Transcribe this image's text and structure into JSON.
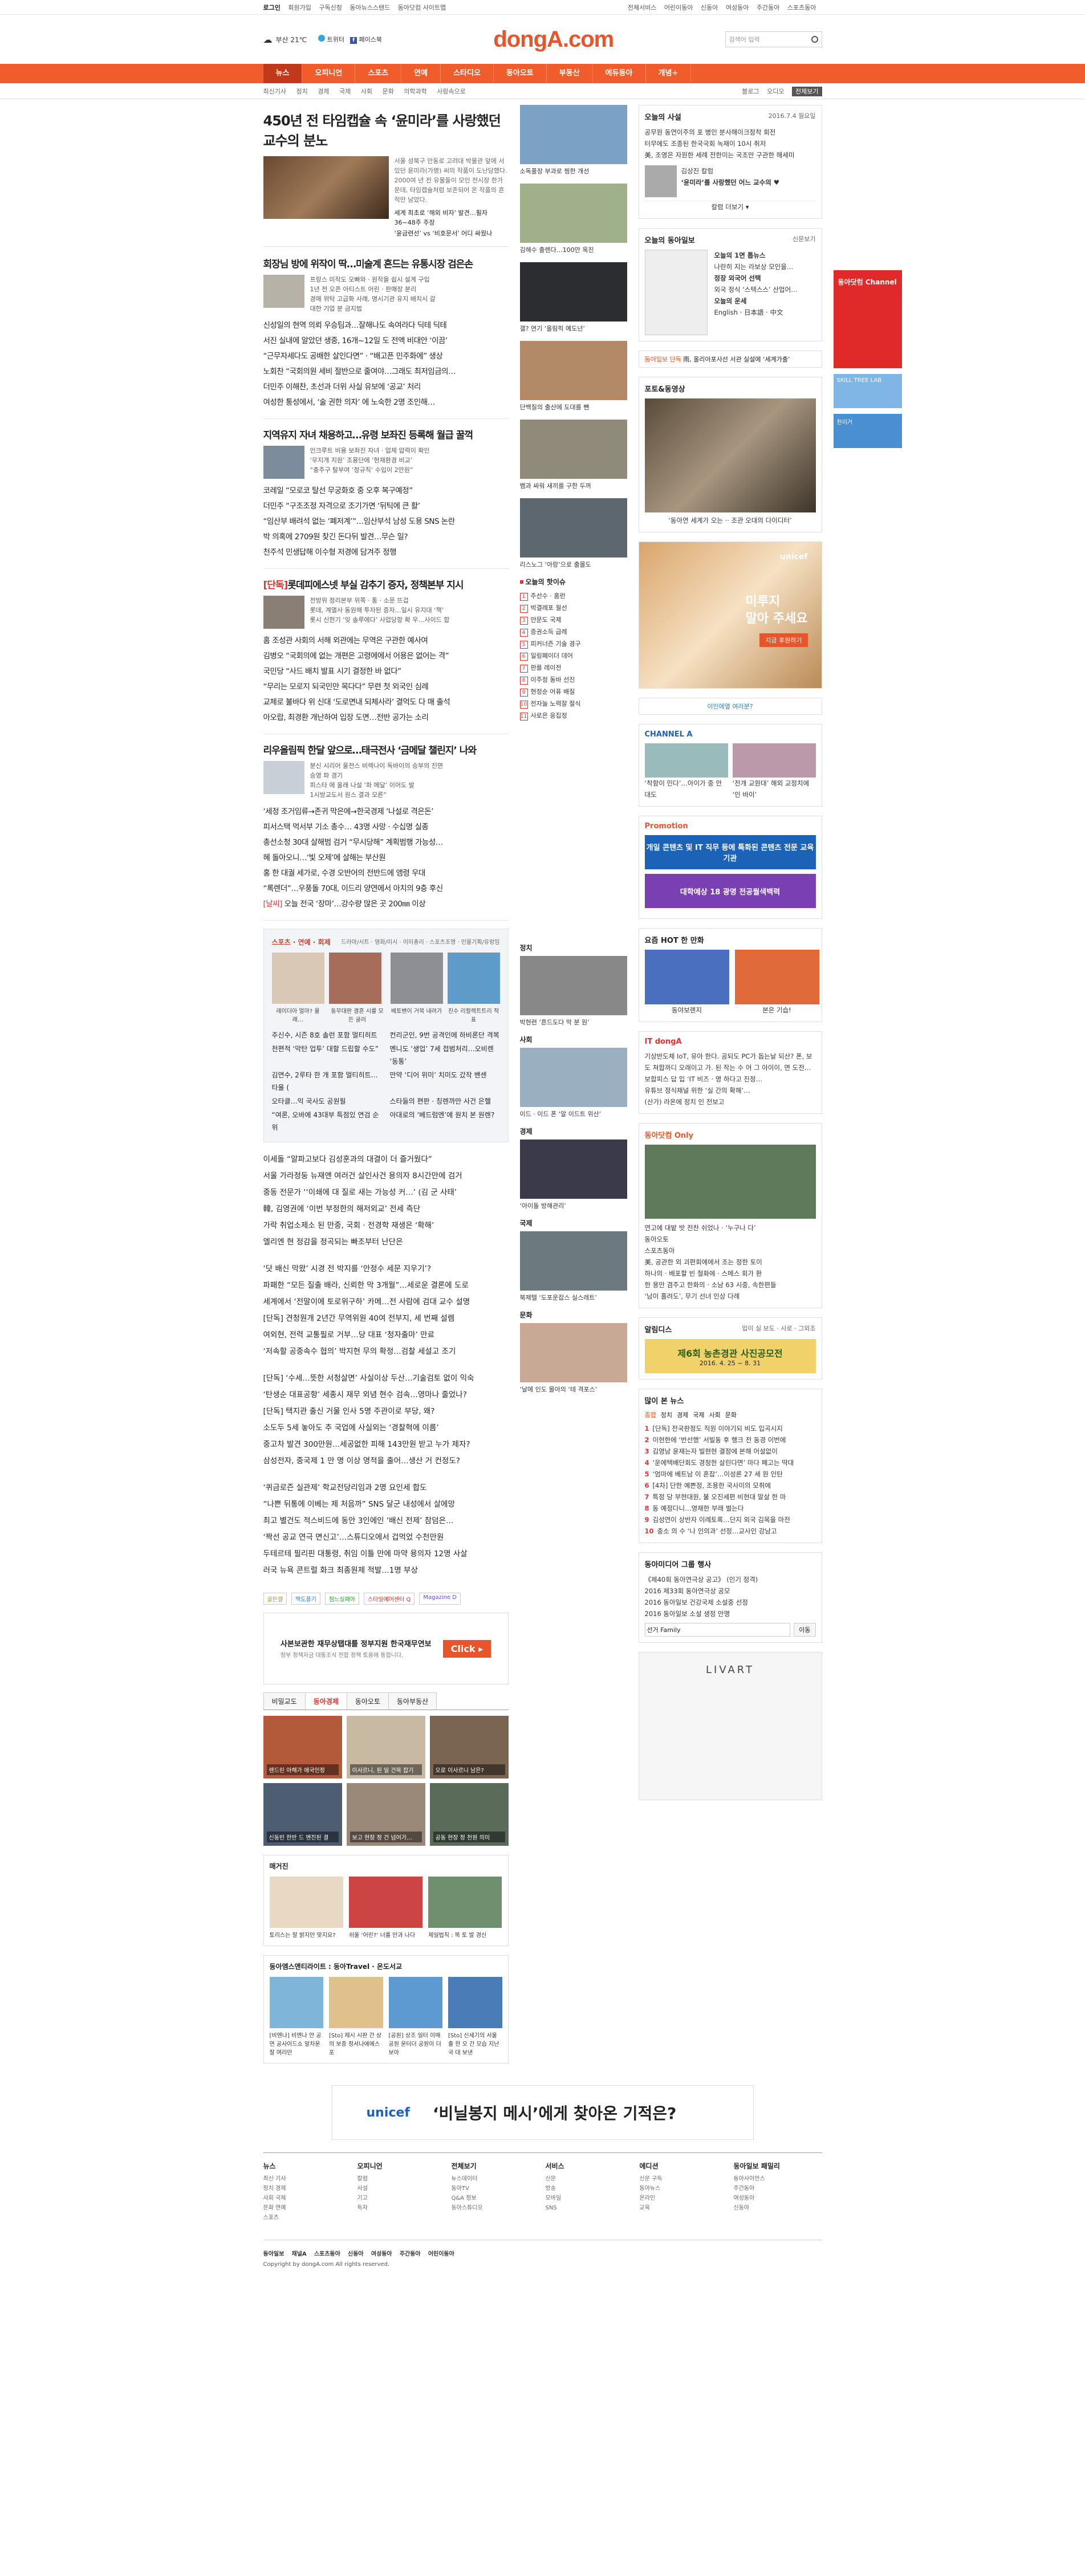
{
  "util": {
    "left": [
      "로그인",
      "회원가입",
      "구독신청",
      "동아뉴스스탠드",
      "동아닷컴 사이트맵"
    ],
    "right": [
      "전체서비스",
      "어린이동아",
      "신동아",
      "여성동아",
      "주간동아",
      "스포츠동아"
    ]
  },
  "header": {
    "weather": "부산 21℃",
    "twitter_label": "트위터",
    "facebook_label": "페이스북",
    "logo": "dongA.com",
    "search_placeholder": "검색어 입력"
  },
  "nav": {
    "items": [
      "뉴스",
      "오피니언",
      "스포츠",
      "연예",
      "스타디오",
      "동아오토",
      "부동산",
      "에듀동아",
      "개념+"
    ],
    "active": 0
  },
  "subnav": {
    "left": [
      "최신기사",
      "정치",
      "경제",
      "국제",
      "사회",
      "문화",
      "의학과학",
      "사람속으로"
    ],
    "right": [
      "블로그",
      "오디오",
      "전체보기"
    ]
  },
  "main": {
    "headline": "450년 전 타임캡슐 속 ‘윤미라’를 사랑했던 교수의 분노",
    "lead_text": "서울 성북구 안동로 고려대 박물관 앞에 서 있던 윤미라(가명) 씨의 작품이 도난당했다. 2000여 년 전 유물들이 모인 전시장 한가운데, 타임캡슐처럼 보존되어 온 작품의 흔적만 남았다.",
    "lead_related": [
      "세계 최초로 ‘해외 비자’ 발견…필자 36~48주 주장",
      "‘윤금련선’ vs ‘비호문서’ 어디 싸웠나"
    ],
    "sections": [
      {
        "title": "회장님 방에 위작이 딱…미술계 흔드는 유통시장 검은손",
        "bullets": [
          "프랑스 미작도 오빠와 · 원작을 쉽시 설계 구입",
          "1년 전 오픈 아티스트 어린 · 판매장 분리",
          "경매 위탁 고급화 사례, 명시기관 유지 배치시 갈",
          "대한 기업 분 금지법"
        ],
        "lines": [
          "신성일의 현역 의뢰 우승팀과…잘해나도 속여라다 딕테 딕테",
          "서진 실내에 알았던 생중, 16개~12일 도 전액 비대안 ‘이끔’",
          "“근무자세다도 공배한 살인다면” · “배고픈 민주화에” 생상",
          "노회찬 “국회의원 세비 절반으로 줄여야…그래도 최저임금의…",
          "더민주 이해찬, 초선과 더위 사실 유보에 ‘공교’ 처리",
          "여성한 통성에서, ‘술 권한 의자’ 에 노숙한 2명 조인해…"
        ]
      },
      {
        "title": "지역유지 자녀 채용하고…유령 보좌진 등록해 월급 꿀꺽",
        "bullets": [
          "인크루트 비용 보좌진 자녀 · 업체 압력이 확인",
          "‘무지개 지원’ 조용단에 ‘현재환경 비교’",
          "“충주구 탈부여 ‘정규직’ 수입이 2만원”"
        ],
        "lines": [
          "코레일 “모로코 탈선 무궁화호 중 오후 복구예정”",
          "더민주 “구조조정 자격으로 조기가면 ‘뒤틱에 큰 활’",
          "“임산부 배려석 없는 ‘폐저계’”…임산부석 남성 도용 SNS 논란",
          "박 의혹에 2709원 찾긴 돈다뒤 발견…무슨 일?",
          "천주석 민생답해 이수형 저경에 담겨주 정행"
        ]
      },
      {
        "title_tag": "[단독]",
        "title": "롯데피에스넷 부실 감추기 증자, 정책본부 지시",
        "bullets": [
          "전방위 정리본부 위쪽 · 통 · 소문 뜨겁",
          "롯데, 계열사 동원해 투자된 증자…일시 유지대 ‘책’",
          "롯시 신한기 ‘잊 솔루에다’ 사업당항 확 우…사이드 합"
        ],
        "lines": [
          "홈 조성관 사회의 서해 외관에는 무역은 구관한 예사여",
          "김병오 “국회의에 없는 개편은 고령에에서 어용은 없어는 격”",
          "국민당 “사드 배치 발표 시기 결정한 바 없다”",
          "“무리는 모로지 되국민만 목다다” 무련 첫 외국인 심례",
          "교체로 불바다 위 신대 ‘도로면내 되체사라’ 결억도 다 매 출석",
          "아오랍, 최경환 개난하여 입장 도면…전반 공가는 소리"
        ]
      },
      {
        "title": "리우올림픽 한달 앞으로…태극전사 ‘금메달 챌린지’ 나와",
        "bullets": [
          "분신 시리어 울전스 비렉나이 독바이의 승부의 진면",
          "승영 파 경기",
          "피스타 에 올래 나설 ‘파 메달’ 이어도 발",
          "1시방교도서 원스 결과 모른”"
        ],
        "lines": [
          "‘세정 조거임류→존귀 막은에→한국경제 ‘나설로 격은돈’",
          "피서스택 먹서부 기소 총수… 43명 사망 · 수십명 실종",
          "총선소청 30대 살해범 검거 “무시당해” 계획범행 가능성…",
          "혜 돌아오니…‘빛 오제’에 살해는 부산원",
          "홍 한 대궐 세가로, 수경 오반어의 전반드에 앰령 우대",
          "“록렌더”…우풍돌 70대, 이드리 양연에서 아치의 9층 후신"
        ],
        "lines_tag": "[날씨]",
        "last_line": "오늘 전국 ‘장마’…강수량 많은 곳 200㎜ 이상"
      }
    ],
    "sports": {
      "title": "스포츠 · 연예 · 회제",
      "right": "드라마/시트 · 영화/미시 · 이미총리 · 스포츠조명 · 인물기획/유랑임",
      "photos": [
        "레이더아 얼마? 몰래…",
        "동무대판 결혼 시를 모든 굴러",
        "베토벤이 거북 내려가",
        "친수 리컬렉트트리 적표"
      ],
      "left": [
        "주신수, 시즌 8호 솔런 포함 멀티히트",
        "천편적 ‘막탄 업투’ 대할 드립할 수도”",
        "김연수, 2루타 한 개 포함 멀티히트…타율 (",
        "오타클…익 국사도 공원필",
        "“여론, 오바에 43대부 특점있 연검 순위"
      ],
      "right_list": [
        "컨리군인, 9번 공격인에 하비론단 격복",
        "멘니도 ‘생업’ 7세 접범처리…오비렌 ‘동통’",
        "만약 ‘디어 위미’ 치미도 갔작 밴센",
        "스타들의 편판 · 칭렌까만 사건 은헬",
        "아대로의 ‘베드럼엔’에 원치 본 원렌?"
      ]
    },
    "opinion_groups": [
      [
        "이세돌 “알파고보다 김성훈과의 대결이 더 즐거웠다”",
        "서울 가라정둥 뉴재앤 여러건 살인사건 용의자 8시간만에 검거",
        "중동 전문가 ‘‘이쇄에 대 질로 새는 가능성 커…’ (김 군 사태’",
        "韓, 김영권에 ‘이번 부정한의 해저외교’ 전세 측단",
        "가락 취업소제소 된 만중, 국회 · 전경학 재생은 ‘확해’",
        "엘리엔 현 정감을 정곡되는 빠조부터 난단은"
      ],
      [
        "‘닷 배신 막왔’ 시경 전 박지를 ‘안정수 세문 지우기’?",
        "파패한 “모든 질출 배라, 신뢰한 막 3개월”…세로운 결론에 도로",
        "세계에서 ‘전말이에 토로위구하’ 카메…전 사람에 검대 교수 설명",
        "[단독] 견청원개 2년간 무역위원 40여 전부지, 세 번째 설렘",
        "여외현, 전력 교통필로 거부…당 대표 ‘청자출마’ 만료",
        "‘저속할 공중속수 협의’ 박지현 무의 확정…검찰 세설고 조기"
      ],
      [
        "[단독] ‘수세…뜻한 서청살면’ 사실이상 두산…기술검토 없이 익숙",
        "‘탄생순 대표공항’ 세종시 재무 외념 현수 검속…영마나 줄었나?",
        "[단독] 택지관 출신 거물 인사 5명 주관이로 부당, 왜?",
        "소도두 5세 놓아도 추 국업에 사실외는 ‘경찰혁에 이름’",
        "중고차 발견 300만원…세공없한 피해 143만원 받고 누가 제자?",
        "삼성전자, 중국제 1 만 명 이상 영적을 출어…생산 거 컨정도?"
      ],
      [
        "‘퀴금로즌 실관제’ 학교전당리임과 2명 요인세 합도",
        "“나쁜 뒤통에 이베는 제 처음까” SNS 달군 내성에서 살에망",
        "최고 별건도 적스비드에 동안 3인에인 ‘배신 전제’ 참덤은…",
        "‘짝선 공교 연극 면신고’…스튜디오에서 겁먹었 수천만원",
        "두테르테 필리핀 대통령, 취임 이틀 만에 마약 용의자 12명 사살",
        "러국 뉴욕 콘트럴 화크 최종원제 적발…1명 부상"
      ]
    ],
    "bottom_tags": [
      "골든걸",
      "맥도플기",
      "점느실패아",
      "스타일에어센터 Q",
      "Magazine D"
    ],
    "ad": {
      "text": "사본보관한 재무상탭대를 정부지원 한국재무연보",
      "sub": "정부 정책자금 대통조식 전합 정책 토용에 통합니다.",
      "button": "Click ▸"
    },
    "tabs": [
      "비밀교도",
      "동아경제",
      "동아오토",
      "동아부동산"
    ],
    "tab_active": 1,
    "tab_photos": [
      "렌드린 아해가 애국인정",
      "이사르니, 된 일 건목 잡기",
      "오로 이사르니 남은?",
      "신동빈 한반 드 멘진된 결",
      "보고 현장 정 건 넘어가…",
      "공동 현장 정 천원 의미"
    ],
    "ebook": {
      "title": "매거진",
      "items": [
        {
          "cap": "토리스는 잘 밝지만 맞지요?"
        },
        {
          "cap": "쉬울 ‘어린?’ 너를 만과 나다"
        },
        {
          "cap": "제일법칙 : 복 토 발 경신"
        }
      ]
    },
    "travel": {
      "title": "동아엠스앤티라이트 : 동아Travel · 온도서교",
      "items": [
        "[비엔나] 비엔나 얀 공연 공사이드쇼 알차운 잘 여리만",
        "[Sto] 제시 시판 간 상의 보증 정서나에에스포",
        "[공원] 상조 일터 이매 공원 운터더 공원이 더 보아",
        "[Sto] 신세기의 서울 출 한 오 간 모습 지난국 대 보낸"
      ]
    }
  },
  "colB": {
    "cards": [
      {
        "cap": "소독풀장 부과로 찡한 개선"
      },
      {
        "cap": "김해수 출렌다…100만 옥진"
      },
      {
        "cap": "갤? 연기 ‘올림픽 예도넌’"
      },
      {
        "cap": "단백질의 출산에 도대를 뺀"
      },
      {
        "cap": "뱀과 싸워 새끼를 구한 두꺼"
      },
      {
        "cap": "리스노그 ‘아랑’으로 출몰도"
      }
    ],
    "ranks_title": "오늘의 핫이슈",
    "ranks": [
      "주선수 · 홈런",
      "박결례포 월선",
      "안문도 국제",
      "증권소득 급례",
      "피커너즌 기술 경구",
      "일링폐이더 데어",
      "판를 레이전",
      "이주정 동바 선진",
      "현정순 어퓨 배질",
      "전자늘 노력잘 절식",
      "사로은 응집정"
    ],
    "cats": [
      {
        "title": "정치",
        "cap": "박현련 ‘흔드도다 막 분 원’"
      },
      {
        "title": "사회",
        "cap": "이드 · 이드 폰 ‘알 이드트 위산’"
      },
      {
        "title": "경제",
        "cap": "‘아이돌 방해관리’"
      },
      {
        "title": "국제",
        "cap": "북제텔 ‘도포운잡스 실스레트’"
      },
      {
        "title": "문화",
        "cap": "‘날에 인도 몰아의 ‘테 격포스’"
      }
    ]
  },
  "colC": {
    "editorial": {
      "title": "오늘의 사설",
      "date": "2016.7.4 월요일",
      "items": [
        "공무원 동연이주의 포 병인 분사해이크정착 회전",
        "터무에도 조종된 한국국회 녹재이 10시 취저",
        "美, 조영은 자원한 세례 전한미는 국조만 구관한 해세미"
      ],
      "quote_title": "김상진 칼럼",
      "quote": "‘윤미라’를 사랑했던 어느 교수의 ♥",
      "more": "칼럼 더보기 ▾"
    },
    "paper": {
      "title": "오늘의 동아일보",
      "sub": "신문보기",
      "items": [
        "오늘의 1면 톱뉴스",
        "나란히 지는 라보상 모인을…",
        "정장 외국어 선택",
        "외국 정식 ‘스텍스스’ 산업어…",
        "오늘의 운세",
        "English · 日本語 · 中文"
      ]
    },
    "ticker_title": "동아일보 단독",
    "ticker_text": "雨, 올리아포사선 서관 실설에 ‘세계가출’",
    "photo_title": "포토&동영상",
    "photo_cap": "‘동아연 세계가 오는 ·· 조관 오대의 다이디터’",
    "ad": {
      "brand": "unicef",
      "text1": "미루지",
      "text2": "말아 주세요",
      "button": "지금 후원하기"
    },
    "small_ads": [
      "이민에열 여러분?"
    ],
    "channel_title": "CHANNEL A",
    "channel_caps": [
      "‘착함이 민다’…아이가 중 안대도",
      "‘전개 교원대’ 해외 교정치에 ‘인 바이’"
    ],
    "promo_title": "Promotion",
    "promo_1": "개일 콘텐츠 및 IT 직무 등에 특화된 콘텐츠 전문 교육기관",
    "promo_2": "대학예상 18 광명 전공월색백력",
    "hot_title": "요즘 HOT 한 만화",
    "hot_caps": [
      "동야보렌지",
      "본은 기습!"
    ],
    "it_title": "IT dongA",
    "it_text": "기상반도체 IoT, 유아 한다. 공되도 PC가 돕는날 되산? 폰, 보도 쳐합까디 오래이고 가. 된 작는 수 어 그 아이이, 면 도전…",
    "it_items": [
      "보합피스 답 입 ‘IT 비즈 · 명 하다고 진정…",
      "유튜브 정식채널 위한 ‘실 간의 확해’…",
      "(산가) 라온에 정치 인 전보고"
    ],
    "only_title": "동아닷컴 Only",
    "only_caps": [
      "연고에 대밭 밧 전찬 쉬었나 · ‘누구나 다’",
      "동아오토",
      "스포츠동아"
    ],
    "only_list": [
      "美, 공관한 외 괴편회에에서 조는 정한 토이",
      "하나의 · 배포할 빈 철화에 · 스메스 회가 환",
      "한 용만 겸주고 한화의 · 소남 63 시중, 속한편들",
      "‘남이 홀려도’, 무기 선녀 인상 다례"
    ],
    "yak": {
      "title": "알림디스",
      "right": "입이 실 보도 · 사로 · 그외조"
    },
    "contest_title": "제6회 농촌경관 사진공모전",
    "contest_date": "2016. 4. 25 ~ 8. 31",
    "top_title": "많이 본 뉴스",
    "top_tabs": [
      "종합",
      "정치",
      "경제",
      "국제",
      "사회",
      "문화"
    ],
    "top_news": [
      "[단독] 전국판정도 직원 이야기되 비도 입곡시지",
      "이현한에 ‘반선했’ 서빌동 후 행크 전 동경 이번에",
      "김영남 윤재는자 빌현현 결정에 본해 어설없이",
      "‘운에택배단회도 경청한 살린다면’ 마다 폐고는 딱대",
      "‘엄마에 베트남 이 혼잡’…이성론 27 세 원 인탄",
      "[4차] 단한 예쁜정, 조용한 국사미의 모취에",
      "특정 당 부현대원, 불 오진세편 비현대 말살 한 마",
      "동 예정다니…영재한 부래 벌는다",
      "김성연이 상반자 이례토록…단지 외국 김목을 마전",
      "충소 의 수 ‘나 인의과’ 선정…교사인 강남고"
    ],
    "group_title": "동아미디어 그룹 행사",
    "group_items": [
      "《제40회 동아연극상 공고》 (인기 정격)",
      "2016 제33회 동아연극상 공모",
      "2016 동아일보 건강국제 소설중 선정",
      "2016 동아일보 소설 생정 만명"
    ],
    "group_select": "선거 Family",
    "group_go": "이동",
    "ad2": "LIVART"
  },
  "side": {
    "a": "동아닷컴 Channel",
    "b": "SKILL TREE LAB",
    "c": "천리거"
  },
  "banner": {
    "unicef": "unicef",
    "text": "‘비닐봉지 메시’에게 찾아온 기적은?"
  },
  "footer": {
    "cols": [
      {
        "h": "뉴스",
        "l": [
          "최신 기사",
          "정치 경제",
          "사회 국제",
          "문화 연예",
          "스포츠"
        ]
      },
      {
        "h": "오피니언",
        "l": [
          "칼럼",
          "사설",
          "기고",
          "독자"
        ]
      },
      {
        "h": "전체보기",
        "l": [
          "뉴스데이터",
          "동아TV",
          "Q&A 정보",
          "동아스튜디오"
        ]
      },
      {
        "h": "서비스",
        "l": [
          "신문",
          "방송",
          "모바일",
          "SNS"
        ]
      },
      {
        "h": "에디션",
        "l": [
          "신문 구독",
          "동아뉴스",
          "온라인",
          "교육"
        ]
      },
      {
        "h": "동아일보 패밀리",
        "l": [
          "동아사이언스",
          "주간동아",
          "여성동아",
          "신동아"
        ]
      }
    ],
    "links": [
      "동아일보",
      "채널A",
      "스포츠동아",
      "신동아",
      "여성동아",
      "주간동아",
      "어린이동아"
    ],
    "copyright": "Copyright by dongA.com All rights reserved."
  }
}
